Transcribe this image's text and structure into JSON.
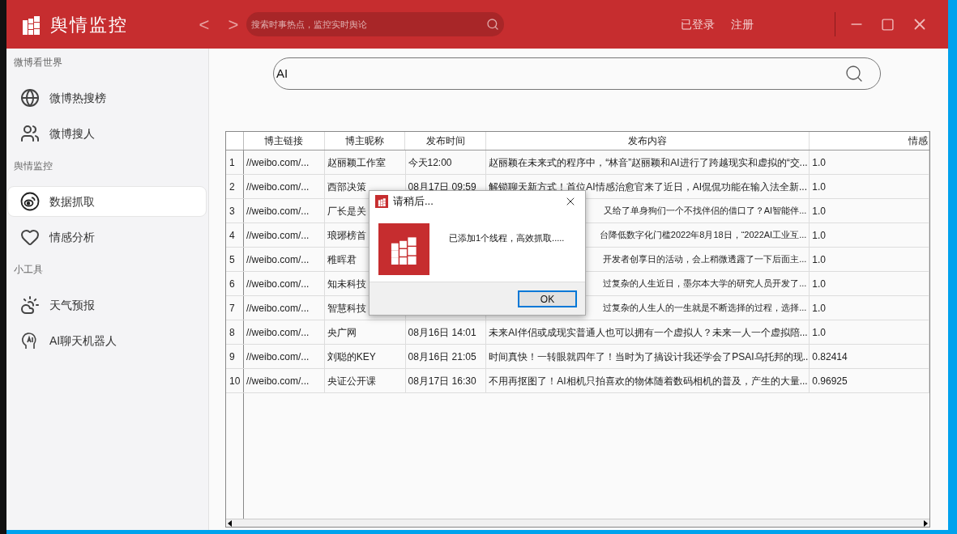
{
  "app": {
    "title": "舆情监控",
    "search_placeholder": "搜索时事热点，监控实时舆论",
    "nav": [
      {
        "label": "<"
      },
      {
        "label": ">"
      }
    ],
    "account": [
      {
        "label": "已登录"
      },
      {
        "label": "注册"
      }
    ]
  },
  "sidebar": {
    "sections": [
      {
        "title": "微博看世界",
        "items": [
          {
            "label": "微博热搜榜",
            "kind": "globe",
            "selected": false
          },
          {
            "label": "微博搜人",
            "kind": "people",
            "selected": false
          }
        ]
      },
      {
        "title": "舆情监控",
        "items": [
          {
            "label": "数据抓取",
            "kind": "weibo",
            "selected": true
          },
          {
            "label": "情感分析",
            "kind": "heart",
            "selected": false
          }
        ]
      },
      {
        "title": "小工具",
        "items": [
          {
            "label": "天气预报",
            "kind": "weather",
            "selected": false
          },
          {
            "label": "AI聊天机器人",
            "kind": "ai",
            "selected": false
          }
        ]
      }
    ]
  },
  "search": {
    "value": "AI"
  },
  "table": {
    "columns": [
      "博主链接",
      "博主昵称",
      "发布时间",
      "发布内容",
      "情感"
    ],
    "rows": [
      {
        "index": "1",
        "cells": [
          "//weibo.com/...",
          "赵丽颖工作室",
          "今天12:00",
          "赵丽颖在未来式的程序中，“林音”赵丽颖和AI进行了跨越现实和虚拟的“交...",
          "1.0"
        ]
      },
      {
        "index": "2",
        "cells": [
          "//weibo.com/...",
          "西部决策",
          "08月17日 09:59",
          "解锁聊天新方式！首位AI情感治愈官来了近日，AI侃侃功能在输入法全新...",
          "1.0"
        ]
      },
      {
        "index": "3",
        "cells": [
          "//weibo.com/...",
          "厂长是关",
          "",
          "又给了单身狗们一个不找伴侣的借口了？AI智能伴...",
          "1.0"
        ]
      },
      {
        "index": "4",
        "cells": [
          "//weibo.com/...",
          "琅琊榜首",
          "",
          "台降低数字化门槛2022年8月18日，“2022AI工业互...",
          "1.0"
        ]
      },
      {
        "index": "5",
        "cells": [
          "//weibo.com/...",
          "稚晖君",
          "",
          "开发者创享日的活动，会上稍微透露了一下后面主...",
          "1.0"
        ]
      },
      {
        "index": "6",
        "cells": [
          "//weibo.com/...",
          "知未科技",
          "",
          "过复杂的人生近日，墨尔本大学的研究人员开发了...",
          "1.0"
        ]
      },
      {
        "index": "7",
        "cells": [
          "//weibo.com/...",
          "智慧科技",
          "",
          "过复杂的人生人的一生就是不断选择的过程，选择...",
          "1.0"
        ]
      },
      {
        "index": "8",
        "cells": [
          "//weibo.com/...",
          "央广网",
          "08月16日 14:01",
          "未来AI伴侣或成现实普通人也可以拥有一个虚拟人？未来一人一个虚拟陪...",
          "1.0"
        ]
      },
      {
        "index": "9",
        "cells": [
          "//weibo.com/...",
          "刘聪的KEY",
          "08月16日 21:05",
          "时间真快！一转眼就四年了！当时为了搞设计我还学会了PSAI乌托邦的现...",
          "0.82414"
        ]
      },
      {
        "index": "10",
        "cells": [
          "//weibo.com/...",
          "央证公开课",
          "08月17日 16:30",
          "不用再抠图了！AI相机只拍喜欢的物体随着数码相机的普及，产生的大量...",
          "0.96925"
        ]
      }
    ]
  },
  "dialog": {
    "title": "请稍后...",
    "message": "已添加1个线程，高效抓取.....",
    "button": "OK"
  }
}
